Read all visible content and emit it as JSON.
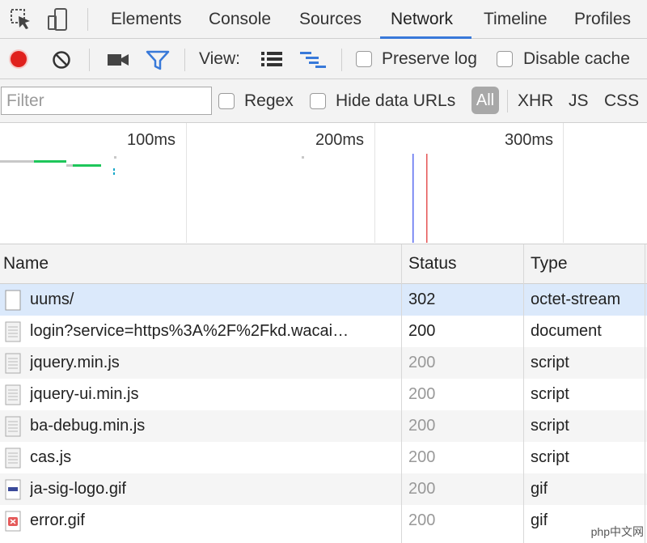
{
  "tabs": {
    "items": [
      {
        "label": "Elements"
      },
      {
        "label": "Console"
      },
      {
        "label": "Sources"
      },
      {
        "label": "Network"
      },
      {
        "label": "Timeline"
      },
      {
        "label": "Profiles"
      }
    ],
    "active": "Network"
  },
  "toolbar": {
    "view_label": "View:",
    "preserve_log_label": "Preserve log",
    "disable_cache_label": "Disable cache",
    "record_color": "#e0211d",
    "accent": "#3879d9"
  },
  "filterbar": {
    "filter_placeholder": "Filter",
    "regex_label": "Regex",
    "hide_data_urls_label": "Hide data URLs",
    "types": [
      "All",
      "XHR",
      "JS",
      "CSS"
    ]
  },
  "overview": {
    "ticks": [
      "100ms",
      "200ms",
      "300ms"
    ]
  },
  "table": {
    "headers": {
      "name": "Name",
      "status": "Status",
      "type": "Type"
    },
    "rows": [
      {
        "name": "uums/",
        "status": "302",
        "type": "octet-stream"
      },
      {
        "name": "login?service=https%3A%2F%2Fkd.wacai…",
        "status": "200",
        "type": "document"
      },
      {
        "name": "jquery.min.js",
        "status": "200",
        "type": "script"
      },
      {
        "name": "jquery-ui.min.js",
        "status": "200",
        "type": "script"
      },
      {
        "name": "ba-debug.min.js",
        "status": "200",
        "type": "script"
      },
      {
        "name": "cas.js",
        "status": "200",
        "type": "script"
      },
      {
        "name": "ja-sig-logo.gif",
        "status": "200",
        "type": "gif"
      },
      {
        "name": "error.gif",
        "status": "200",
        "type": "gif"
      }
    ]
  },
  "watermark": "php中文网"
}
